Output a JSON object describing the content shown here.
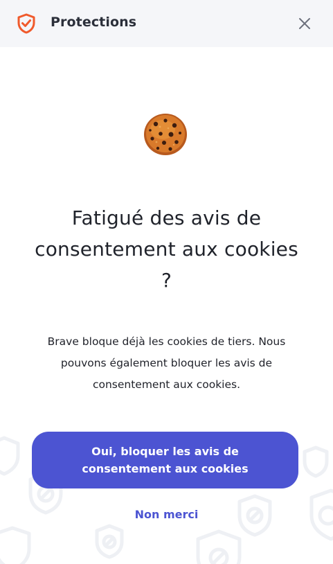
{
  "header": {
    "title": "Protections",
    "brand_icon": "shield-check-icon",
    "close_icon": "close-icon",
    "accent": "#f05a2c"
  },
  "main": {
    "illustration": "cookie-icon",
    "headline": "Fatigué des avis de consentement aux cookies ?",
    "description": "Brave bloque déjà les cookies de tiers. Nous pouvons également bloquer les avis de consentement aux cookies.",
    "primary_button_label": "Oui, bloquer les avis de consentement aux cookies",
    "secondary_link_label": "Non merci",
    "background_decoration": "shield-pattern"
  },
  "colors": {
    "header_bg": "#f5f6f9",
    "primary": "#4c54d2",
    "text": "#1f2129"
  }
}
